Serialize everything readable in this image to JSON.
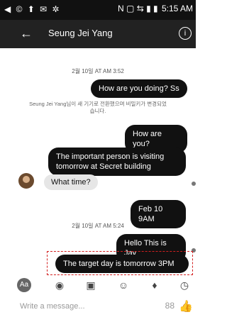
{
  "status_bar": {
    "left_icons": "◀ © ⬆ ✉ ✲",
    "right_icons": "N ▢ ⇆ ▮ ▮",
    "time": "5:15 AM"
  },
  "header": {
    "back_icon": "←",
    "title": "Seung Jei Yang",
    "info_icon": "i"
  },
  "conversation": {
    "timestamp_1": "2월 10일 AT AM 3:52",
    "msg_1": "How are you doing? Ss",
    "notice": "Seung Jei Yang님이 새 기기로 전환했으며 비밀키가 변경되었습니다.",
    "msg_2": "How are you?",
    "msg_3": "The important person is visiting tomorrow at Secret building",
    "incoming_1": "What time?",
    "msg_4": "Feb 10 9AM",
    "timestamp_2": "2월 10일 AT AM 5:24",
    "msg_5": "Hello This is Jay",
    "msg_6": "The target day is tomorrow 3PM"
  },
  "toolbar": {
    "icons": [
      "Aa",
      "camera-icon",
      "image-icon",
      "emoji-icon",
      "location-icon",
      "timer-icon"
    ]
  },
  "composer": {
    "placeholder": "Write a message...",
    "sticker_icon": "88",
    "like_icon": "👍"
  }
}
